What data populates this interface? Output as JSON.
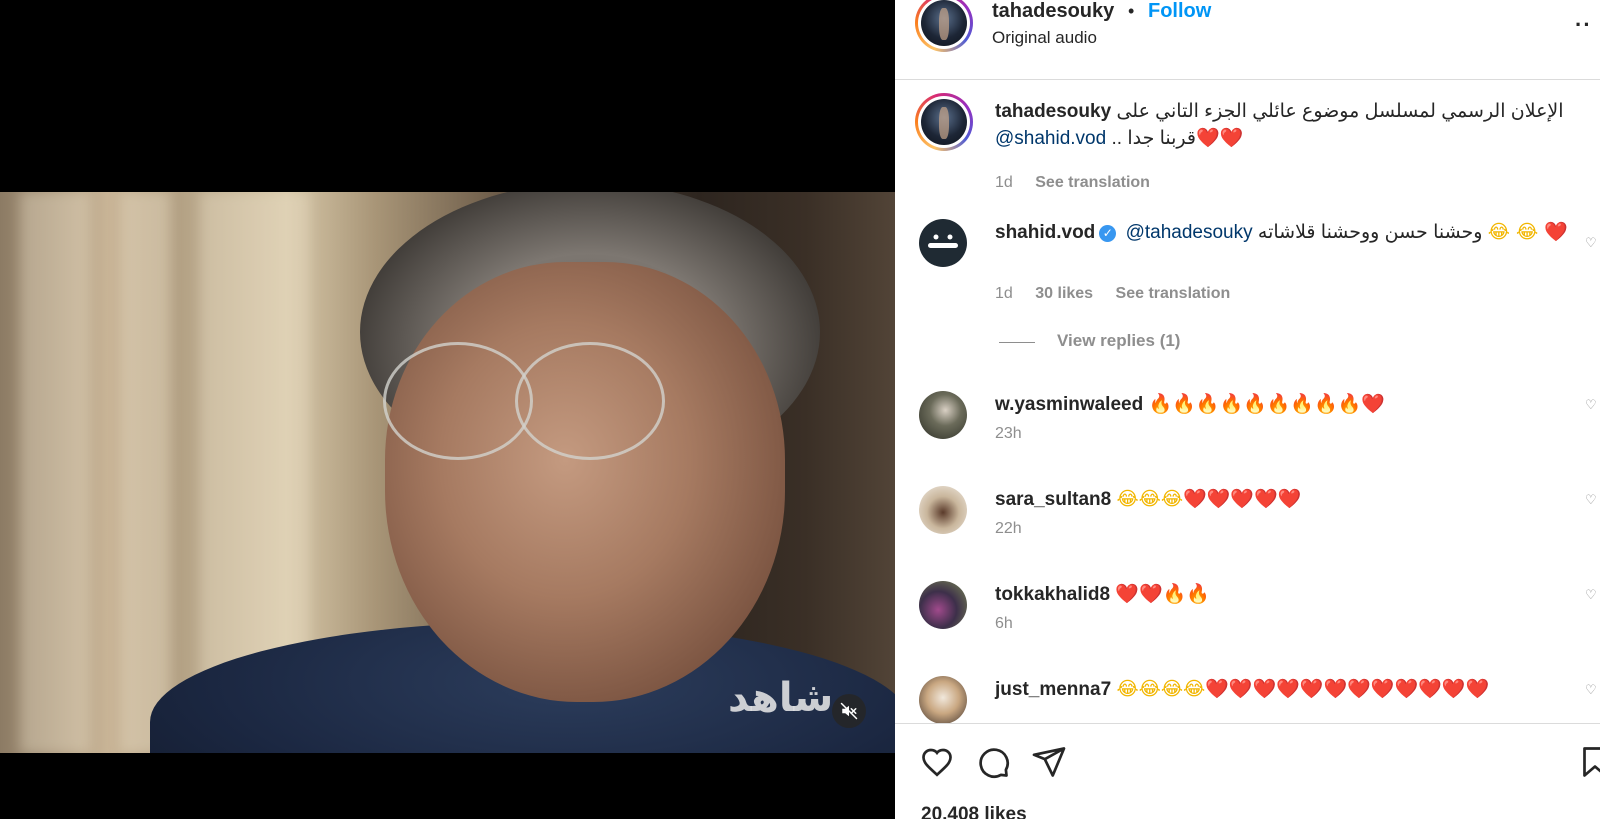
{
  "header": {
    "username": "tahadesouky",
    "separator": "•",
    "follow_label": "Follow",
    "audio_label": "Original audio",
    "more_label": "··"
  },
  "video": {
    "watermark": "شاهد"
  },
  "caption": {
    "username": "tahadesouky",
    "text_ar": "الإعلان الرسمي لمسلسل موضوع عائلي الجزء التاني على",
    "mention": "@shahid.vod",
    "tail_ar": "قربنا جدا ..",
    "tail_emoji": "❤️❤️",
    "time": "1d",
    "see_translation": "See translation"
  },
  "comments": [
    {
      "username": "shahid.vod",
      "verified": true,
      "mention": "@tahadesouky",
      "text_ar": "وحشنا حسن ووحشنا قلاشاته",
      "emoji": "😂 😂 ❤️",
      "time": "1d",
      "likes": "30 likes",
      "see_translation": "See translation",
      "view_replies": "View replies (1)"
    },
    {
      "username": "w.yasminwaleed",
      "emoji": "🔥🔥🔥🔥🔥🔥🔥🔥🔥❤️",
      "time": "23h"
    },
    {
      "username": "sara_sultan8",
      "emoji": "😂😂😂❤️❤️❤️❤️❤️",
      "time": "22h"
    },
    {
      "username": "tokkakhalid8",
      "emoji": "❤️❤️🔥🔥",
      "time": "6h"
    },
    {
      "username": "just_menna7",
      "emoji": "😂😂😂😂❤️❤️❤️❤️❤️❤️❤️❤️❤️❤️❤️❤️",
      "time": ""
    }
  ],
  "footer": {
    "likes_count": "20,408 likes"
  },
  "colors": {
    "follow_blue": "#0095f6",
    "mention_blue": "#00376b",
    "muted_gray": "#8e8e8e",
    "verified_blue": "#3897f0"
  },
  "icons": [
    "mute-icon",
    "heart-icon",
    "comment-icon",
    "share-icon",
    "bookmark-icon",
    "verified-badge-icon",
    "more-icon"
  ]
}
